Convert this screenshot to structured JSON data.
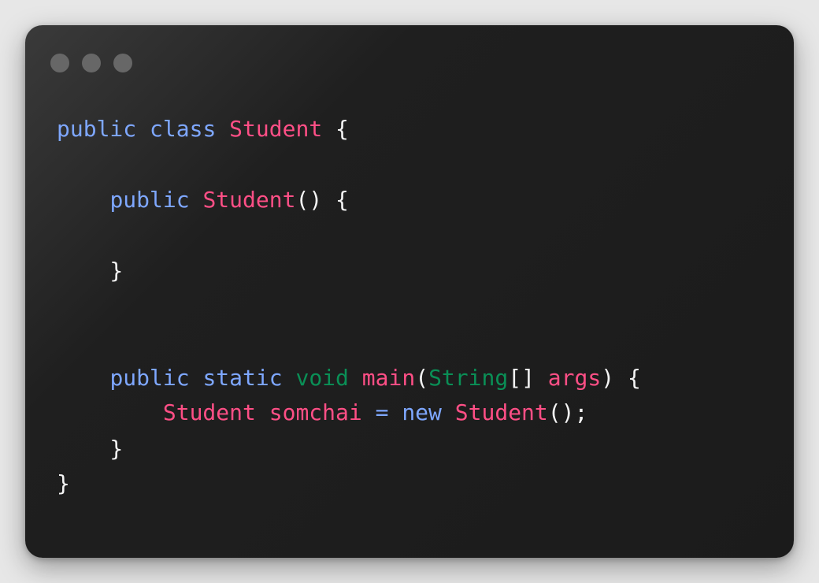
{
  "window": {
    "controls": [
      {
        "name": "window-control-1"
      },
      {
        "name": "window-control-2"
      },
      {
        "name": "window-control-3"
      }
    ]
  },
  "code": {
    "lines": [
      {
        "tokens": [
          {
            "text": "public",
            "cls": "kw"
          },
          {
            "text": " ",
            "cls": "plain"
          },
          {
            "text": "class",
            "cls": "kw"
          },
          {
            "text": " ",
            "cls": "plain"
          },
          {
            "text": "Student",
            "cls": "type"
          },
          {
            "text": " {",
            "cls": "plain"
          }
        ]
      },
      {
        "tokens": [
          {
            "text": "    ",
            "cls": "plain"
          },
          {
            "text": "public",
            "cls": "kw"
          },
          {
            "text": " ",
            "cls": "plain"
          },
          {
            "text": "Student",
            "cls": "type"
          },
          {
            "text": "() {",
            "cls": "plain"
          }
        ]
      },
      {
        "tokens": [
          {
            "text": "    }",
            "cls": "plain"
          }
        ]
      },
      {
        "tokens": [
          {
            "text": "    ",
            "cls": "plain"
          },
          {
            "text": "public",
            "cls": "kw"
          },
          {
            "text": " ",
            "cls": "plain"
          },
          {
            "text": "static",
            "cls": "kw"
          },
          {
            "text": " ",
            "cls": "plain"
          },
          {
            "text": "void",
            "cls": "green"
          },
          {
            "text": " ",
            "cls": "plain"
          },
          {
            "text": "main",
            "cls": "type"
          },
          {
            "text": "(",
            "cls": "plain"
          },
          {
            "text": "String",
            "cls": "green"
          },
          {
            "text": "[] ",
            "cls": "plain"
          },
          {
            "text": "args",
            "cls": "type"
          },
          {
            "text": ") {",
            "cls": "plain"
          }
        ]
      },
      {
        "tokens": [
          {
            "text": "        ",
            "cls": "plain"
          },
          {
            "text": "Student",
            "cls": "type"
          },
          {
            "text": " ",
            "cls": "plain"
          },
          {
            "text": "somchai",
            "cls": "type"
          },
          {
            "text": " ",
            "cls": "plain"
          },
          {
            "text": "=",
            "cls": "kw"
          },
          {
            "text": " ",
            "cls": "plain"
          },
          {
            "text": "new",
            "cls": "kw"
          },
          {
            "text": " ",
            "cls": "plain"
          },
          {
            "text": "Student",
            "cls": "type"
          },
          {
            "text": "();",
            "cls": "plain"
          }
        ]
      },
      {
        "tokens": [
          {
            "text": "    }",
            "cls": "plain"
          }
        ]
      },
      {
        "tokens": [
          {
            "text": "}",
            "cls": "plain"
          }
        ]
      }
    ]
  }
}
